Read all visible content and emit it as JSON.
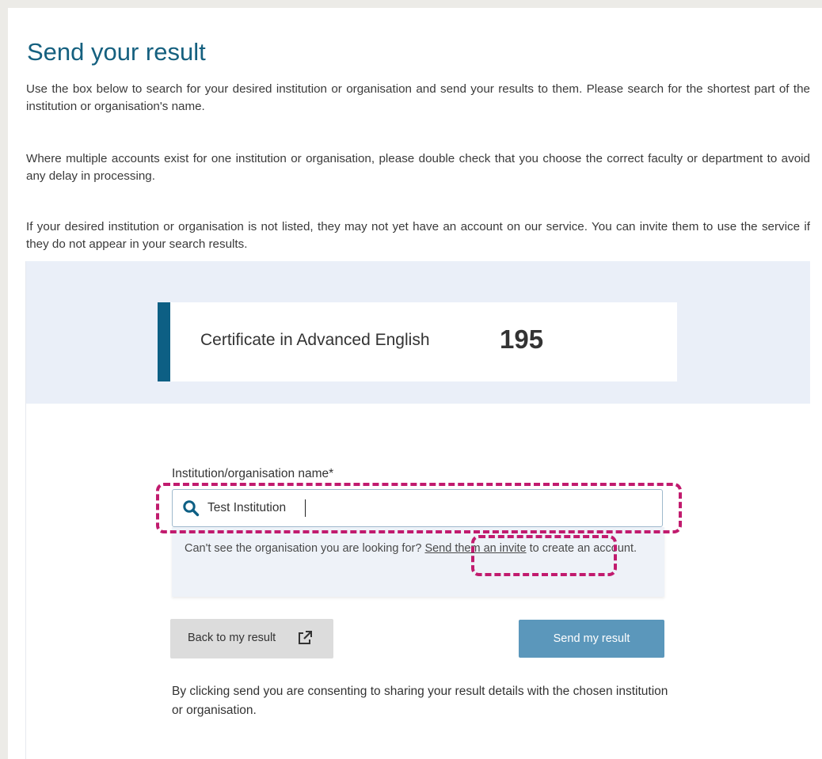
{
  "page": {
    "title": "Send your result",
    "paragraphs": [
      "Use the box below to search for your desired institution or organisation and send your results to them. Please search for the shortest part of the institution or organisation's name.",
      "Where multiple accounts exist for one institution or organisation, please double check that you choose the correct faculty or department to avoid any delay in processing.",
      "If your desired institution or organisation is not listed, they may not yet have an account on our service. You can invite them to use the service if they do not appear in your search results."
    ]
  },
  "result": {
    "exam": "Certificate in Advanced English",
    "score": "195"
  },
  "search": {
    "label": "Institution/organisation name*",
    "value": "Test Institution",
    "icon": "search-icon"
  },
  "invite": {
    "prefix": "Can't see the organisation you are looking for? ",
    "link": "Send them an invite",
    "suffix": " to create an account."
  },
  "actions": {
    "back_label": "Back to my result",
    "back_icon": "external-link-icon",
    "send_label": "Send my result"
  },
  "consent": "By clicking send you are consenting to sharing your result details with the chosen institution or organisation.",
  "colors": {
    "title": "#15607f",
    "accent_bar": "#0d5f84",
    "send_button": "#5b97bb",
    "highlight": "#c11b6e",
    "panel_band": "#eaeff8"
  }
}
